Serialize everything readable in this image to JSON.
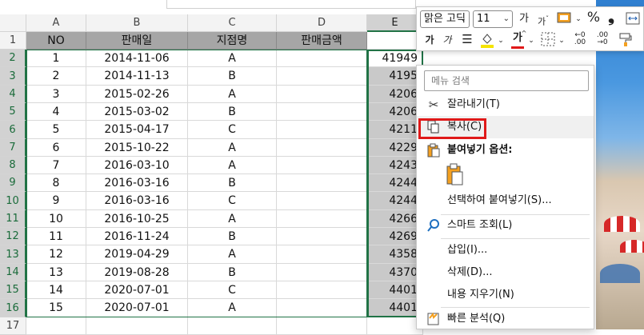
{
  "columns": [
    "A",
    "B",
    "C",
    "D",
    "E"
  ],
  "header_row": {
    "row": "1",
    "cells": [
      "NO",
      "판매일",
      "지점명",
      "판매금액",
      ""
    ]
  },
  "rows": [
    {
      "row": "2",
      "no": "1",
      "date": "2014-11-06",
      "branch": "A",
      "amount": "",
      "e": "41949"
    },
    {
      "row": "3",
      "no": "2",
      "date": "2014-11-13",
      "branch": "B",
      "amount": "",
      "e": "4195"
    },
    {
      "row": "4",
      "no": "3",
      "date": "2015-02-26",
      "branch": "A",
      "amount": "",
      "e": "4206"
    },
    {
      "row": "5",
      "no": "4",
      "date": "2015-03-02",
      "branch": "B",
      "amount": "",
      "e": "4206"
    },
    {
      "row": "6",
      "no": "5",
      "date": "2015-04-17",
      "branch": "C",
      "amount": "",
      "e": "4211"
    },
    {
      "row": "7",
      "no": "6",
      "date": "2015-10-22",
      "branch": "A",
      "amount": "",
      "e": "4229"
    },
    {
      "row": "8",
      "no": "7",
      "date": "2016-03-10",
      "branch": "A",
      "amount": "",
      "e": "4243"
    },
    {
      "row": "9",
      "no": "8",
      "date": "2016-03-16",
      "branch": "B",
      "amount": "",
      "e": "4244"
    },
    {
      "row": "10",
      "no": "9",
      "date": "2016-03-16",
      "branch": "C",
      "amount": "",
      "e": "4244"
    },
    {
      "row": "11",
      "no": "10",
      "date": "2016-10-25",
      "branch": "A",
      "amount": "",
      "e": "4266"
    },
    {
      "row": "12",
      "no": "11",
      "date": "2016-11-24",
      "branch": "B",
      "amount": "",
      "e": "4269"
    },
    {
      "row": "13",
      "no": "12",
      "date": "2019-04-29",
      "branch": "A",
      "amount": "",
      "e": "4358"
    },
    {
      "row": "14",
      "no": "13",
      "date": "2019-08-28",
      "branch": "B",
      "amount": "",
      "e": "4370"
    },
    {
      "row": "15",
      "no": "14",
      "date": "2020-07-01",
      "branch": "C",
      "amount": "",
      "e": "4401"
    },
    {
      "row": "16",
      "no": "15",
      "date": "2020-07-01",
      "branch": "A",
      "amount": "",
      "e": "4401"
    },
    {
      "row": "17",
      "no": "",
      "date": "",
      "branch": "",
      "amount": "",
      "e": ""
    }
  ],
  "mini_toolbar": {
    "font_name": "맑은 고딕",
    "font_size": "11",
    "grow_font": "가",
    "shrink_font": "가",
    "percent": "%",
    "comma": "❟",
    "bold": "가",
    "italic": "가",
    "align": "☰",
    "font_color_glyph": "가",
    "inc_decimal": "←0",
    "dec_decimal": ".00"
  },
  "context_menu": {
    "search_placeholder": "메뉴 검색",
    "items": [
      {
        "label": "잘라내기(T)",
        "icon": "scissors-icon"
      },
      {
        "label": "복사(C)",
        "icon": "copy-icon"
      },
      {
        "label": "붙여넣기 옵션:",
        "icon": "paste-icon"
      },
      {
        "label": "선택하여 붙여넣기(S)...",
        "icon": ""
      },
      {
        "label": "스마트 조회(L)",
        "icon": "smart-lookup-icon"
      },
      {
        "label": "삽입(I)...",
        "icon": ""
      },
      {
        "label": "삭제(D)...",
        "icon": ""
      },
      {
        "label": "내용 지우기(N)",
        "icon": ""
      },
      {
        "label": "빠른 분석(Q)",
        "icon": "quick-analysis-icon"
      }
    ]
  },
  "colors": {
    "accent": "#217346",
    "highlight": "#e01919",
    "header_fill": "#a6a6a6"
  }
}
